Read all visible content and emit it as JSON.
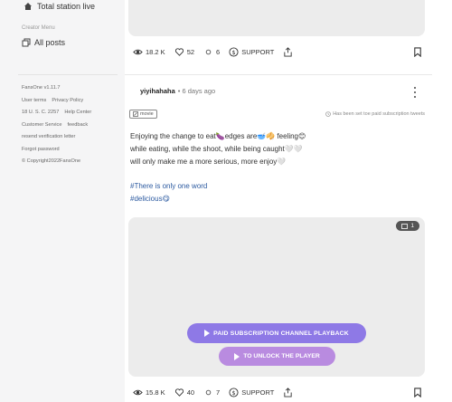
{
  "sidebar": {
    "live_label": "Total station live",
    "menu_title": "Creator Menu",
    "posts_label": "All posts",
    "footer": {
      "version": "FansOne v1.11.7",
      "user_terms": "User terms",
      "privacy_policy": "Privacy Policy",
      "usc": "18 U. S. C. 2257",
      "help_center": "Help Center",
      "customer_service": "Customer Service",
      "feedback": "feedback",
      "resend": "resend verification letter",
      "forgot": "Forgot password",
      "copyright": "© Copyright2022FansOne"
    }
  },
  "post1": {
    "views": "18.2 K",
    "likes": "52",
    "comments": "6",
    "support": "SUPPORT"
  },
  "post2": {
    "author": "yiyihahaha",
    "time": "• 6 days ago",
    "tag": "movie",
    "notice": "Has been set toe paid subscription tweets",
    "lines": [
      "Enjoying the change to eat🍆edges are🥣🥠 feeling😊",
      "while eating, while the shoot, while being caught🤍🤍",
      "will only make me a more serious, more enjoy🤍"
    ],
    "hashtags": [
      "#There is only one word",
      "#delicious😋"
    ],
    "image_count": "1",
    "pay_button": "PAID SUBSCRIPTION CHANNEL PLAYBACK",
    "unlock_button": "TO UNLOCK THE PLAYER",
    "views": "15.8 K",
    "likes": "40",
    "comments": "7",
    "support": "SUPPORT"
  },
  "colors": {
    "accent_purple": "#8e79e6",
    "accent_pink_purple": "#b98be0",
    "hashtag_blue": "#2c5aa0"
  }
}
